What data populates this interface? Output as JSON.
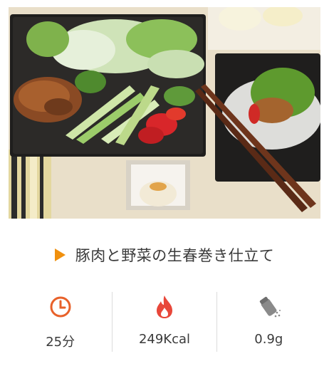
{
  "recipe": {
    "title": "豚肉と野菜の生春巻き仕立て",
    "photo_icon": "food-photo"
  },
  "stats": [
    {
      "icon": "clock-icon",
      "value": "25分",
      "color": "#e8612a"
    },
    {
      "icon": "flame-icon",
      "value": "249Kcal",
      "color": "#e8473a"
    },
    {
      "icon": "salt-shaker-icon",
      "value": "0.9g",
      "color": "#8a8a8a"
    }
  ],
  "colors": {
    "accent": "#f0900e",
    "divider": "#dcdcdc"
  }
}
